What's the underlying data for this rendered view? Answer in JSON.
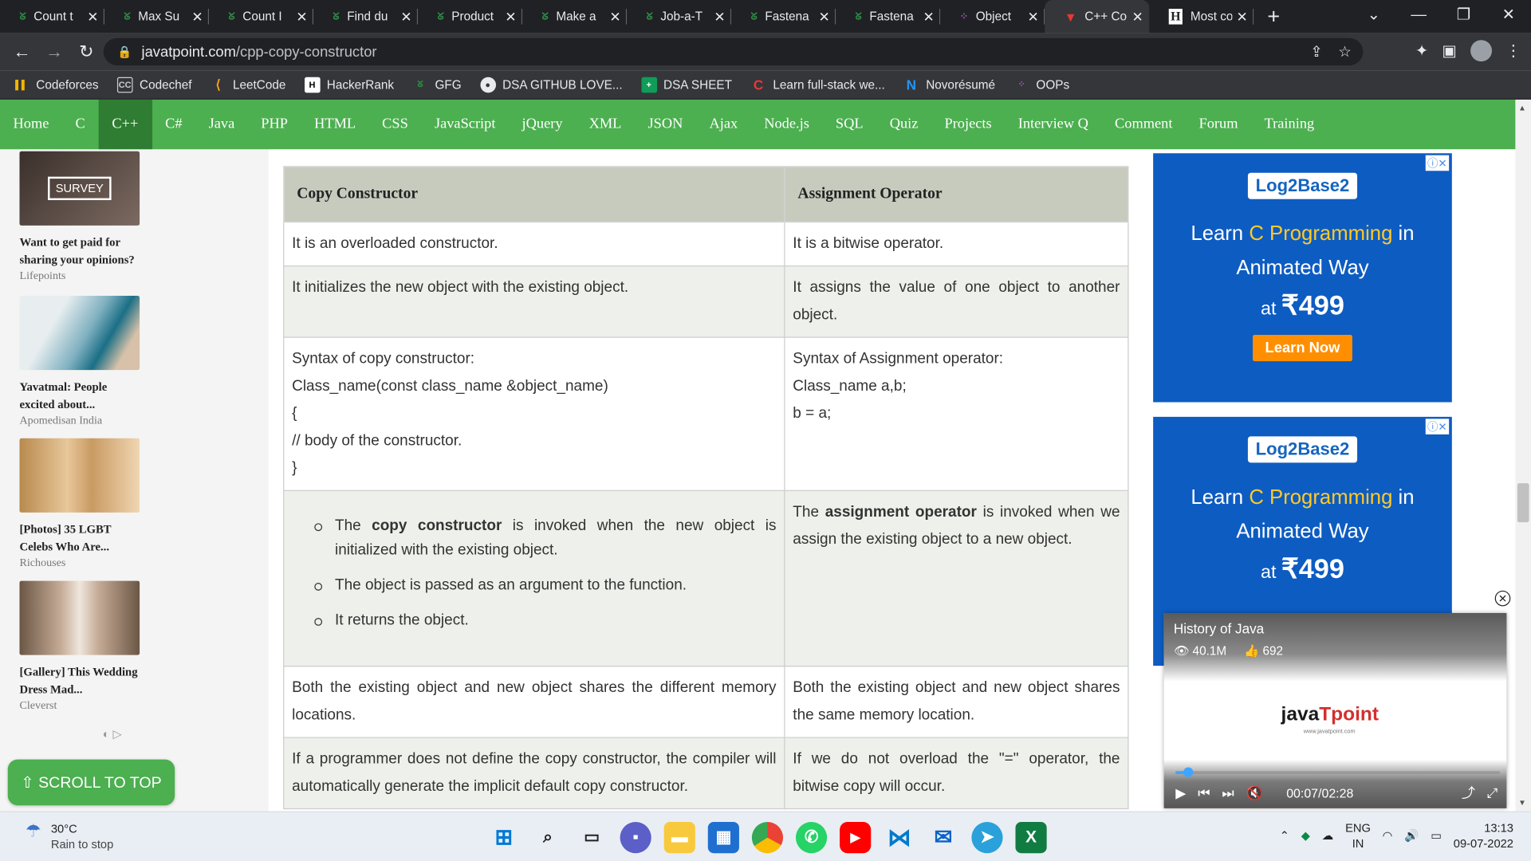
{
  "tabs": [
    {
      "label": "Count t",
      "icon": "gfg-icon"
    },
    {
      "label": "Max Su",
      "icon": "gfg-icon"
    },
    {
      "label": "Count I",
      "icon": "gfg-icon"
    },
    {
      "label": "Find du",
      "icon": "gfg-icon"
    },
    {
      "label": "Product",
      "icon": "gfg-icon"
    },
    {
      "label": "Make a",
      "icon": "gfg-icon"
    },
    {
      "label": "Job-a-T",
      "icon": "gfg-icon"
    },
    {
      "label": "Fastena",
      "icon": "gfg-icon"
    },
    {
      "label": "Fastena",
      "icon": "gfg-icon"
    },
    {
      "label": "Object",
      "icon": "object-icon"
    },
    {
      "label": "C++ Co",
      "icon": "javatpoint-icon",
      "active": true
    },
    {
      "label": "Most co",
      "icon": "h-icon"
    }
  ],
  "address": {
    "host": "javatpoint.com",
    "path": "/cpp-copy-constructor"
  },
  "bookmarks": [
    "Codeforces",
    "Codechef",
    "LeetCode",
    "HackerRank",
    "GFG",
    "DSA GITHUB LOVE...",
    "DSA SHEET",
    "Learn full-stack we...",
    "Novorésumé",
    "OOPs"
  ],
  "menu": [
    "Home",
    "C",
    "C++",
    "C#",
    "Java",
    "PHP",
    "HTML",
    "CSS",
    "JavaScript",
    "jQuery",
    "XML",
    "JSON",
    "Ajax",
    "Node.js",
    "SQL",
    "Quiz",
    "Projects",
    "Interview Q",
    "Comment",
    "Forum",
    "Training"
  ],
  "left_ads": [
    {
      "title": "Want to get paid for sharing your opinions?",
      "source": "Lifepoints",
      "image_text": "SURVEY"
    },
    {
      "title": "Yavatmal: People excited about...",
      "source": "Apomedisan India"
    },
    {
      "title": "[Photos] 35 LGBT Celebs Who Are...",
      "source": "Richouses"
    },
    {
      "title": "[Gallery] This Wedding Dress Mad...",
      "source": "Cleverst"
    }
  ],
  "scroll_top_label": "⇧ SCROLL TO TOP",
  "table": {
    "headers": [
      "Copy Constructor",
      "Assignment Operator"
    ],
    "row1": [
      "It is an overloaded constructor.",
      "It is a bitwise operator."
    ],
    "row2": [
      "It initializes the new object with the existing object.",
      "It assigns the value of one object to another object."
    ],
    "row3_left": [
      "Syntax of copy constructor:",
      "Class_name(const class_name &object_name)",
      "{",
      "// body of the constructor.",
      "}"
    ],
    "row3_right": [
      "Syntax of Assignment operator:",
      "Class_name a,b;",
      "b = a;"
    ],
    "row4_left": {
      "b1_pre": "The ",
      "b1_bold": "copy constructor",
      "b1_post": " is invoked when the new object is initialized with the existing object.",
      "b2": "The object is passed as an argument to the function.",
      "b3": "It returns the object."
    },
    "row4_right": {
      "pre": "The ",
      "bold": "assignment operator",
      "post": " is invoked when we assign the existing object to a new object."
    },
    "row5": [
      "Both the existing object and new object shares the different memory locations.",
      "Both the existing object and new object shares the same memory location."
    ],
    "row6": [
      "If a programmer does not define the copy constructor, the compiler will automatically generate the implicit default copy constructor.",
      "If we do not overload the \"=\" operator, the bitwise copy will occur."
    ]
  },
  "right_ad": {
    "brand": "Log2Base2",
    "line1": "Learn",
    "line1_hl": "C Programming",
    "line1_end": "in",
    "line2": "Animated Way",
    "price_pre": "at",
    "price": "₹499",
    "button": "Learn Now"
  },
  "video": {
    "title": "History of Java",
    "views": "40.1M",
    "likes": "692",
    "logo_a": "java",
    "logo_b": "point",
    "logo_sub": "www.javatpoint.com",
    "time": "00:07/02:28",
    "progress": 0.04
  },
  "taskbar": {
    "temp": "30°C",
    "weather": "Rain to stop",
    "lang1": "ENG",
    "lang2": "IN",
    "time": "13:13",
    "date": "09-07-2022"
  }
}
